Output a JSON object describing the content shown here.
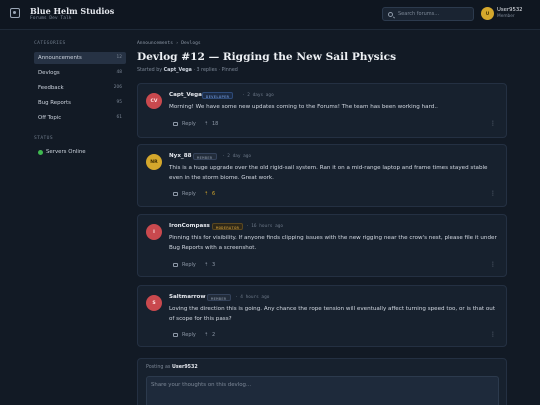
{
  "app": {
    "brand": "Blue Helm Studios",
    "tagline": "Forums Dev Talk",
    "search_placeholder": "Search forums...",
    "user": {
      "initials": "U",
      "name": "User9532",
      "role": "Member"
    }
  },
  "sidebar": {
    "categories_heading": "CATEGORIES",
    "items": [
      {
        "label": "Announcements",
        "count": "12",
        "active": true
      },
      {
        "label": "Devlogs",
        "count": "48"
      },
      {
        "label": "Feedback",
        "count": "206"
      },
      {
        "label": "Bug Reports",
        "count": "95"
      },
      {
        "label": "Off Topic",
        "count": "61"
      }
    ],
    "status_heading": "STATUS",
    "status_text": "Servers Online",
    "status_color": "#3fb950"
  },
  "thread": {
    "breadcrumb": "Announcements › Devlogs",
    "title": "Devlog #12 — Rigging the New Sail Physics",
    "meta_prefix": "Started by",
    "meta_author": "Capt_Vega",
    "meta_rest": "· 3 replies · Pinned"
  },
  "posts": [
    {
      "initials": "CV",
      "avatar_color": "#c9494e",
      "avatar_text": "#ffe4e4",
      "author": "Capt_Vega",
      "badge": "DEVELOPER",
      "badge_type": "dev",
      "time": "· 2 days ago",
      "body": "Morning! We have some new updates coming to the Forums! The team has been working hard..",
      "reply_label": "Reply",
      "upvotes": "18",
      "upvoted": false
    },
    {
      "initials": "NR",
      "avatar_color": "#d4a72c",
      "avatar_text": "#3d2c00",
      "author": "Nyx_88",
      "badge": "MEMBER",
      "badge_type": "mem",
      "time": "· 2 day ago",
      "body": "This is a huge upgrade over the old rigid-sail system. Ran it on a mid-range laptop and frame times stayed stable even in the storm biome. Great work.",
      "reply_label": "Reply",
      "upvotes": "6",
      "upvoted": true
    },
    {
      "initials": "I",
      "avatar_color": "#c9494e",
      "avatar_text": "#ffe4e4",
      "author": "IronCompass",
      "badge": "MODERATOR",
      "badge_type": "mod",
      "time": "· 16 hours ago",
      "body": "Pinning this for visibility. If anyone finds clipping issues with the new rigging near the crow's nest, please file it under Bug Reports with a screenshot.",
      "reply_label": "Reply",
      "upvotes": "3",
      "upvoted": false
    },
    {
      "initials": "S",
      "avatar_color": "#c9494e",
      "avatar_text": "#ffe4e4",
      "author": "Saltmarrow",
      "badge": "MEMBER",
      "badge_type": "mem",
      "time": "· 4 hours ago",
      "body": "Loving the direction this is going. Any chance the rope tension will eventually affect turning speed too, or is that out of scope for this pass?",
      "reply_label": "Reply",
      "upvotes": "2",
      "upvoted": false
    }
  ],
  "composer": {
    "posting_as_label": "Posting as",
    "posting_as_user": "User9532",
    "placeholder": "Share your thoughts on this devlog..."
  },
  "icons": {
    "search": "search-icon",
    "logo": "helm-logo-icon",
    "reply": "reply-icon",
    "upvote": "upvote-icon",
    "more": "more-icon"
  }
}
